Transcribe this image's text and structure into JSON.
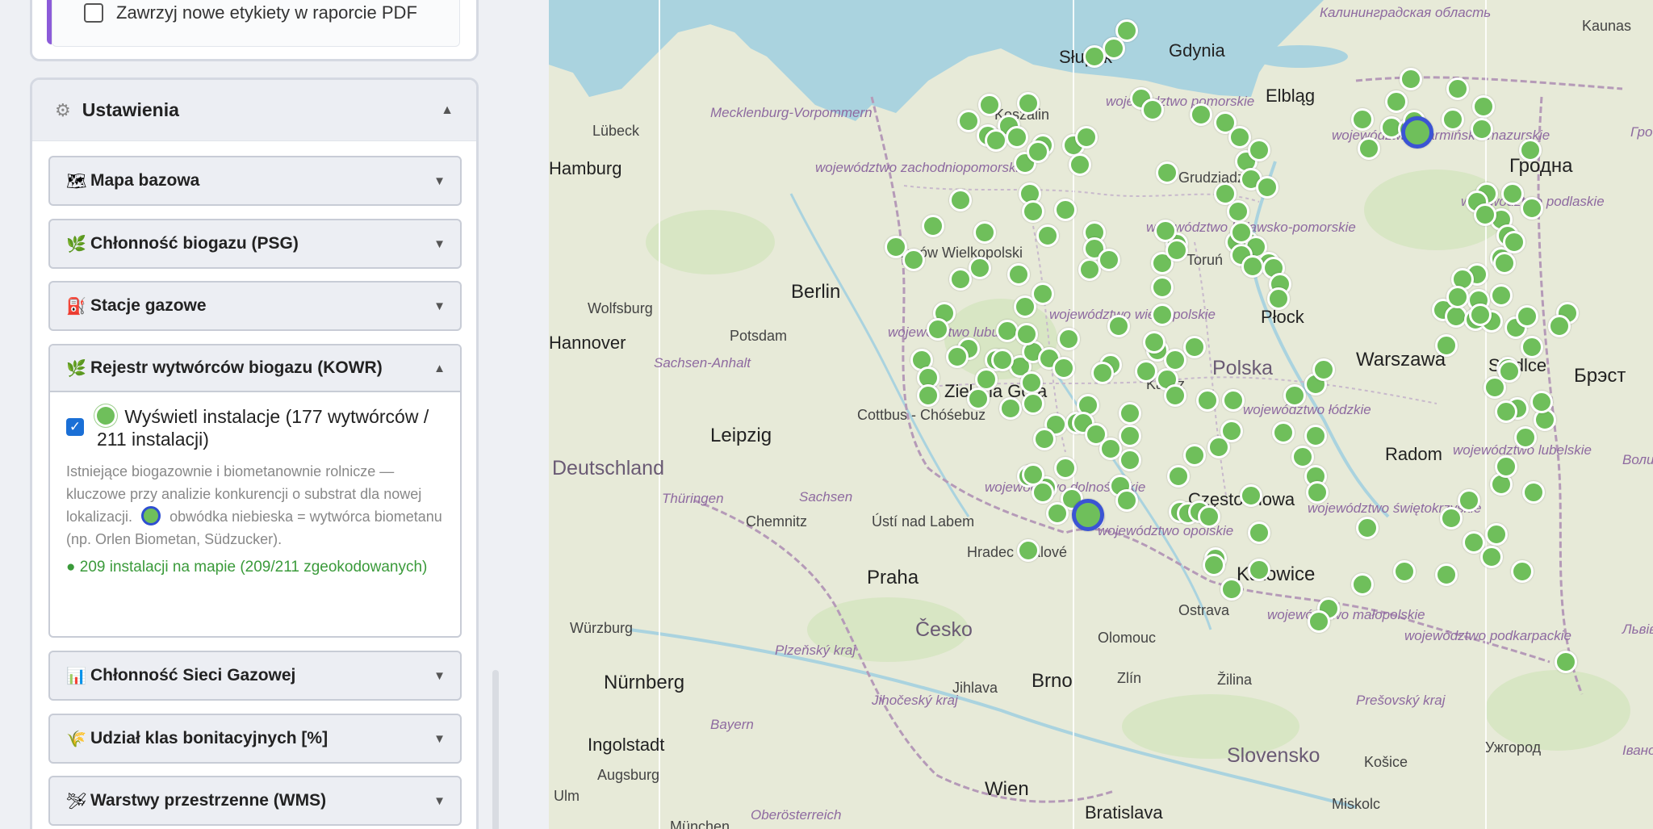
{
  "sidebar": {
    "top_checkbox_label": "Zawrzyj nowe etykiety w raporcie PDF",
    "settings": {
      "title": "Ustawienia",
      "icon": "gear-icon",
      "arrow": "▲"
    },
    "sections": [
      {
        "label": "Mapa bazowa",
        "icon": "map-icon",
        "glyph": "🗺",
        "arrow": "▼"
      },
      {
        "label": "Chłonność biogazu (PSG)",
        "icon": "leaf-icon",
        "glyph": "🌿",
        "arrow": "▼"
      },
      {
        "label": "Stacje gazowe",
        "icon": "gas-pump-icon",
        "glyph": "⛽",
        "arrow": "▼"
      },
      {
        "label": "Rejestr wytwórców biogazu (KOWR)",
        "icon": "leaf-icon",
        "glyph": "🌿",
        "arrow": "▲"
      },
      {
        "label": "Chłonność Sieci Gazowej",
        "icon": "bar-chart-icon",
        "glyph": "📊",
        "arrow": "▼"
      },
      {
        "label": "Udział klas bonitacyjnych [%]",
        "icon": "wheat-icon",
        "glyph": "🌾",
        "arrow": "▼"
      },
      {
        "label": "Warstwy przestrzenne (WMS)",
        "icon": "layers-icon",
        "glyph": "🛩",
        "arrow": "▼"
      }
    ],
    "kowr": {
      "checkbox_label": "Wyświetl instalacje (177 wytwórców / 211 instalacji)",
      "checked": true,
      "description_part1": "Istniejące biogazownie i biometanownie rolnicze — kluczowe przy analizie konkurencji o substrat dla nowej lokalizacji.",
      "description_part2": "obwódka niebieska = wytwórca biometanu (np. Orlen Biometan, Südzucker).",
      "status": "● 209 instalacji na mapie (209/211 zgeokodowanych)"
    }
  },
  "map": {
    "colors": {
      "sea": "#aad3df",
      "land": "#e7ead8",
      "marker": "#6fbf5b",
      "biomethane_outline": "#3b54d4"
    },
    "cities": [
      "Słupsk",
      "Gdynia",
      "Elbląg",
      "Lübeck",
      "Hamburg",
      "Gorzów Wielkopolski",
      "Berlin",
      "Potsdam",
      "Wolfsburg",
      "Hannover",
      "Płock",
      "Warszawa",
      "Siedlce",
      "Брэст",
      "Гродна",
      "Kaunas",
      "Leipzig",
      "Cottbus - Chóśebuz",
      "Zielona Góra",
      "Chemnitz",
      "Ústí nad Labem",
      "Praha",
      "Hradec Králové",
      "Częstochowa",
      "Katowice",
      "Radom",
      "Ostrava",
      "Olomouc",
      "Brno",
      "Zlín",
      "Žilina",
      "Jihlava",
      "Nürnberg",
      "Würzburg",
      "Ingolstadt",
      "Augsburg",
      "Ulm",
      "München",
      "Wien",
      "Bratislava",
      "Košice",
      "Miskolc",
      "Ужгород",
      "Koszalin",
      "Grudziądz",
      "Kalisz",
      "Toruń"
    ],
    "regions": [
      "Калининградская область",
      "województwo pomorskie",
      "województwo warmińsko-mazurskie",
      "województwo zachodniopomorskie",
      "województwo kujawsko-pomorskie",
      "województwo lubuskie",
      "województwo wielkopolskie",
      "województwo łódzkie",
      "województwo dolnośląskie",
      "województwo opolskie",
      "województwo świętokrzyskie",
      "województwo małopolskie",
      "województwo podkarpackie",
      "województwo lubelskie",
      "województwo podlaskie",
      "Mecklenburg-Vorpommern",
      "Sachsen-Anhalt",
      "Sachsen",
      "Thüringen",
      "Plzeňský kraj",
      "Jihočeský kraj",
      "Bayern",
      "Prešovský kraj",
      "Волинська область",
      "Гродзенская вобласць",
      "Львівська область",
      "Івано-Франківська область",
      "Oberösterreich"
    ],
    "countries": [
      "Deutschland",
      "Polska",
      "Česko",
      "Slovensko"
    ]
  }
}
